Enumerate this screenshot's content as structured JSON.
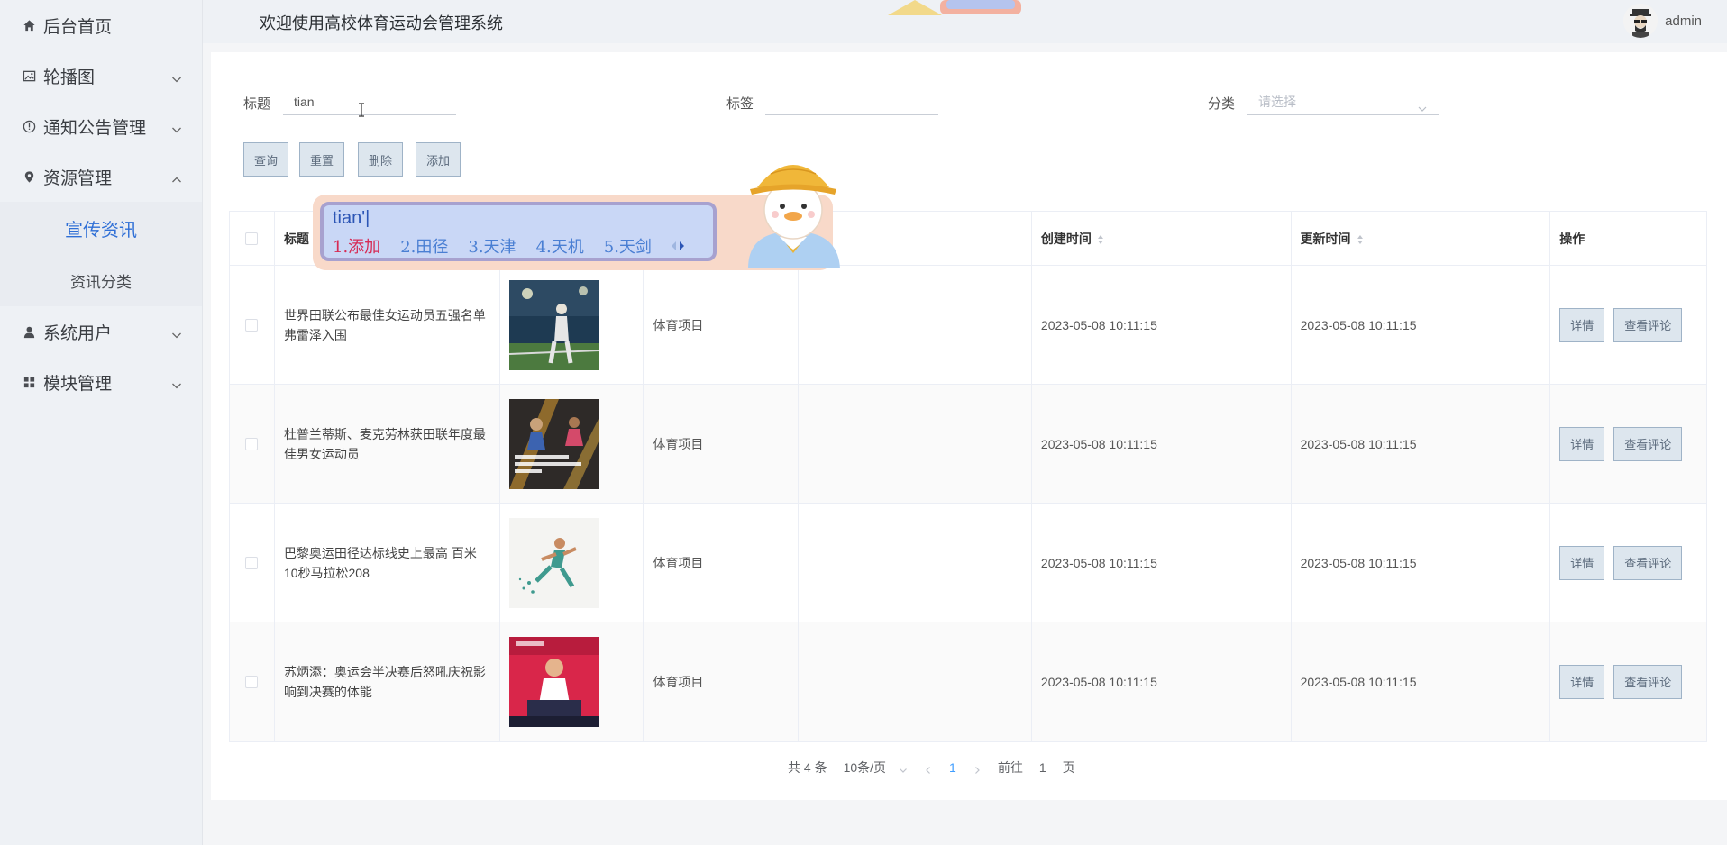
{
  "header": {
    "title": "欢迎使用高校体育运动会管理系统",
    "user": "admin"
  },
  "sidebar": {
    "items": [
      {
        "label": "后台首页",
        "icon": "home-icon"
      },
      {
        "label": "轮播图",
        "icon": "image-icon"
      },
      {
        "label": "通知公告管理",
        "icon": "info-icon"
      },
      {
        "label": "资源管理",
        "icon": "location-icon"
      },
      {
        "label": "系统用户",
        "icon": "user-icon"
      },
      {
        "label": "模块管理",
        "icon": "grid-icon"
      }
    ],
    "submenu": [
      {
        "label": "宣传资讯"
      },
      {
        "label": "资讯分类"
      }
    ]
  },
  "search": {
    "title_label": "标题",
    "title_value": "tian",
    "tag_label": "标签",
    "tag_value": "",
    "category_label": "分类",
    "category_placeholder": "请选择"
  },
  "buttons": {
    "query": "查询",
    "reset": "重置",
    "delete": "删除",
    "add": "添加"
  },
  "table": {
    "headers": {
      "title": "标题",
      "created": "创建时间",
      "updated": "更新时间",
      "actions": "操作"
    },
    "rows": [
      {
        "title": "世界田联公布最佳女运动员五强名单 弗雷泽入围",
        "category": "体育项目",
        "tag": "",
        "created": "2023-05-08 10:11:15",
        "updated": "2023-05-08 10:11:15"
      },
      {
        "title": "杜普兰蒂斯、麦克劳林获田联年度最佳男女运动员",
        "category": "体育项目",
        "tag": "",
        "created": "2023-05-08 10:11:15",
        "updated": "2023-05-08 10:11:15"
      },
      {
        "title": "巴黎奥运田径达标线史上最高 百米10秒马拉松208",
        "category": "体育项目",
        "tag": "",
        "created": "2023-05-08 10:11:15",
        "updated": "2023-05-08 10:11:15"
      },
      {
        "title": "苏炳添：奥运会半决赛后怒吼庆祝影响到决赛的体能",
        "category": "体育项目",
        "tag": "",
        "created": "2023-05-08 10:11:15",
        "updated": "2023-05-08 10:11:15"
      }
    ],
    "row_actions": {
      "detail": "详情",
      "comments": "查看评论"
    }
  },
  "pagination": {
    "total": "共 4 条",
    "page_size": "10条/页",
    "current_page": "1",
    "goto_prefix": "前往",
    "goto_value": "1",
    "goto_suffix": "页"
  },
  "ime": {
    "input": "tian'|",
    "candidates": [
      "1.添加",
      "2.田径",
      "3.天津",
      "4.天机",
      "5.天剑"
    ]
  }
}
